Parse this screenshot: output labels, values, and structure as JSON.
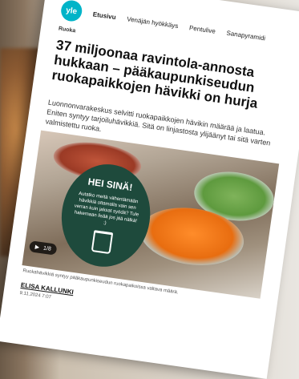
{
  "nav": {
    "logo": "yle",
    "items": [
      {
        "label": "Etusivu",
        "active": true
      },
      {
        "label": "Venäjän hyökkäys",
        "active": false
      },
      {
        "label": "Pentulive",
        "active": false
      },
      {
        "label": "Sanapyramidi",
        "active": false
      }
    ]
  },
  "article": {
    "category": "Ruoka",
    "headline": "37 miljoonaa ravintola-annosta hukkaan – pääkaupunkiseudun ruokapaikkojen hävikki on hurja",
    "lead": "Luonnonvarakeskus selvitti ruokapaikkojen hävikin määrää ja laatua. Eniten syntyy tarjoiluhävikkiä. Sitä on linjastosta ylijäänyt tai sitä varten valmistettu ruoka.",
    "image": {
      "sign_title": "HEI SINÄ!",
      "sign_text": "Autatko meitä vähentämään hävikkiä ottamalla vain sen verran kuin jaksat syödä? Tule hakemaan lisää jos jää nälkä! :)",
      "counter": "1/8"
    },
    "caption": "Ruokahävikkiä syntyy pääkaupunkiseudun ruokapaikoissa valtava määrä.",
    "author": "ELISA KALLUNKI",
    "date": "9.11.2024 7:07"
  },
  "colors": {
    "brand": "#00b4c8",
    "sign": "#1e4a3c"
  }
}
